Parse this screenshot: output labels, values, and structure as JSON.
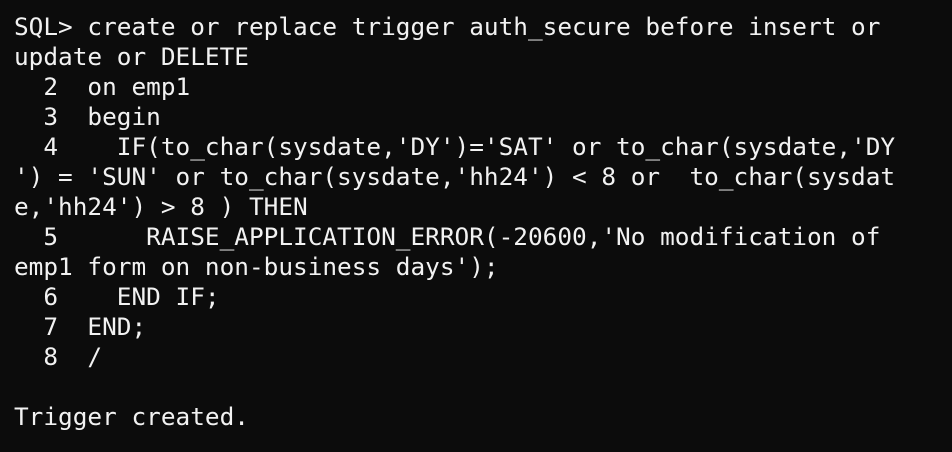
{
  "terminal": {
    "lines": [
      "SQL> create or replace trigger auth_secure before insert or",
      "update or DELETE",
      "  2  on emp1",
      "  3  begin",
      "  4    IF(to_char(sysdate,'DY')='SAT' or to_char(sysdate,'DY",
      "') = 'SUN' or to_char(sysdate,'hh24') < 8 or  to_char(sysdat",
      "e,'hh24') > 8 ) THEN",
      "  5      RAISE_APPLICATION_ERROR(-20600,'No modification of",
      "emp1 form on non-business days');",
      "  6    END IF;",
      "  7  END;",
      "  8  /",
      "",
      "Trigger created."
    ]
  }
}
